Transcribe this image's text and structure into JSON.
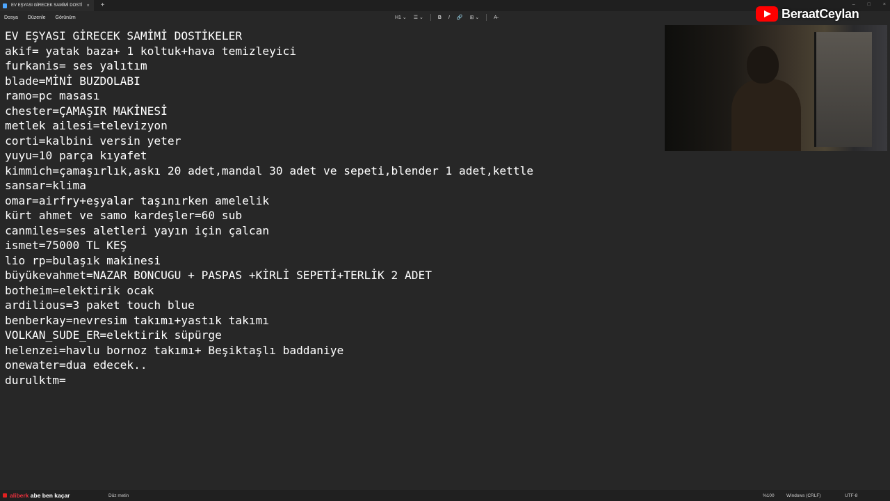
{
  "window": {
    "tab_title": "EV EŞYASI GİRECEK SAMİMİ DOSTİ",
    "tab_close": "×",
    "new_tab": "+",
    "controls": [
      "–",
      "□",
      "×"
    ]
  },
  "menu": [
    "Dosya",
    "Düzenle",
    "Görünüm"
  ],
  "toolbar": {
    "heading": "H1 ⌄",
    "list": "☰ ⌄",
    "bold": "B",
    "italic": "I",
    "link": "🔗",
    "table": "⊞ ⌄",
    "clear_format": "A̶"
  },
  "document": {
    "lines": [
      "EV EŞYASI GİRECEK SAMİMİ DOSTİKELER",
      "akif= yatak baza+ 1 koltuk+hava temizleyici",
      "furkanis= ses yalıtım",
      "blade=MİNİ BUZDOLABI",
      "ramo=pc masası",
      "chester=ÇAMAŞIR MAKİNESİ",
      "metlek ailesi=televizyon",
      "corti=kalbini versin yeter",
      "yuyu=10 parça kıyafet",
      "kimmich=çamaşırlık,askı 20 adet,mandal 30 adet ve sepeti,blender 1 adet,kettle",
      "sansar=klima",
      "omar=airfry+eşyalar taşınırken amelelik",
      "kürt ahmet ve samo kardeşler=60 sub",
      "canmiles=ses aletleri yayın için çalcan",
      "ismet=75000 TL KEŞ",
      "lio rp=bulaşık makinesi",
      "büyükevahmet=NAZAR BONCUGU + PASPAS +KİRLİ SEPETİ+TERLİK 2 ADET",
      "botheim=elektirik ocak",
      "ardilious=3 paket touch blue",
      "benberkay=nevresim takımı+yastık takımı",
      "VOLKAN_SUDE_ER=elektirik süpürge",
      "helenzei=havlu bornoz takımı+ Beşiktaşlı baddaniye",
      "onewater=dua edecek..",
      "durulktm="
    ]
  },
  "overlay": {
    "channel_name": "BeraatCeylan",
    "chat_user": "aliberk",
    "chat_message": "abe ben kaçar"
  },
  "status": {
    "mode": "Düz metin",
    "zoom": "%100",
    "line_ending": "Windows (CRLF)",
    "encoding": "UTF-8"
  }
}
